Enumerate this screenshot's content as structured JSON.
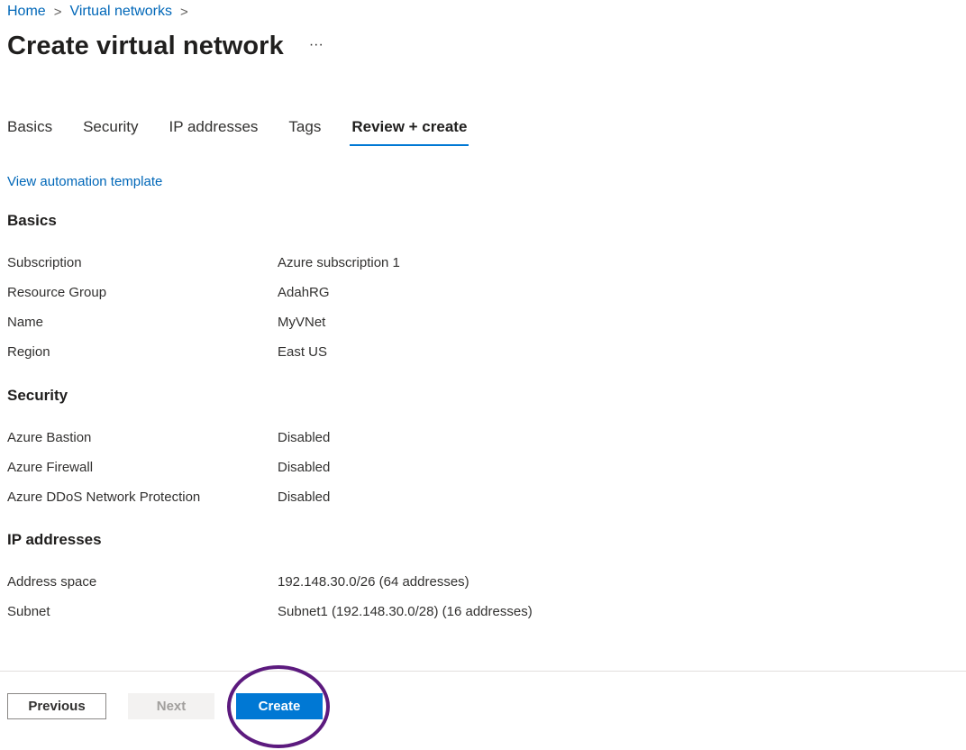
{
  "breadcrumb": {
    "items": [
      "Home",
      "Virtual networks"
    ],
    "separator": ">"
  },
  "page": {
    "title": "Create virtual network",
    "more": "···"
  },
  "tabs": [
    {
      "label": "Basics",
      "active": false
    },
    {
      "label": "Security",
      "active": false
    },
    {
      "label": "IP addresses",
      "active": false
    },
    {
      "label": "Tags",
      "active": false
    },
    {
      "label": "Review + create",
      "active": true
    }
  ],
  "automation_link": "View automation template",
  "sections": {
    "basics": {
      "heading": "Basics",
      "rows": [
        {
          "label": "Subscription",
          "value": "Azure subscription 1"
        },
        {
          "label": "Resource Group",
          "value": "AdahRG"
        },
        {
          "label": "Name",
          "value": "MyVNet"
        },
        {
          "label": "Region",
          "value": "East US"
        }
      ]
    },
    "security": {
      "heading": "Security",
      "rows": [
        {
          "label": "Azure Bastion",
          "value": "Disabled"
        },
        {
          "label": "Azure Firewall",
          "value": "Disabled"
        },
        {
          "label": "Azure DDoS Network Protection",
          "value": "Disabled"
        }
      ]
    },
    "ip": {
      "heading": "IP addresses",
      "rows": [
        {
          "label": "Address space",
          "value": "192.148.30.0/26 (64 addresses)"
        },
        {
          "label": "Subnet",
          "value": "Subnet1 (192.148.30.0/28) (16 addresses)"
        }
      ]
    }
  },
  "footer": {
    "previous": "Previous",
    "next": "Next",
    "create": "Create"
  },
  "colors": {
    "accent": "#0078d4",
    "link": "#0067b8",
    "highlight_ring": "#5c1a7e"
  }
}
